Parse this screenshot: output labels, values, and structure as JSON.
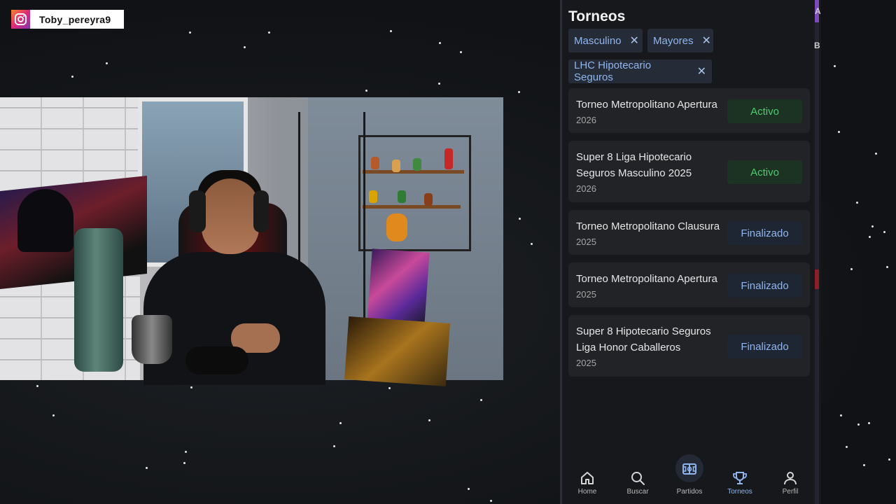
{
  "overlay": {
    "instagram_handle": "Toby_pereyra9"
  },
  "app": {
    "title": "Torneos",
    "filters": [
      {
        "label": "Masculino"
      },
      {
        "label": "Mayores"
      },
      {
        "label": "LHC Hipotecario Seguros"
      }
    ],
    "filter_remove_glyph": "✕",
    "tournaments": [
      {
        "name": "Torneo Metropolitano Apertura",
        "year": "2026",
        "status": "Activo"
      },
      {
        "name": "Super 8 Liga Hipotecario Seguros Masculino 2025",
        "year": "2026",
        "status": "Activo"
      },
      {
        "name": "Torneo Metropolitano Clausura",
        "year": "2025",
        "status": "Finalizado"
      },
      {
        "name": "Torneo Metropolitano Apertura",
        "year": "2025",
        "status": "Finalizado"
      },
      {
        "name": "Super 8 Hipotecario Seguros Liga Honor Caballeros",
        "year": "2025",
        "status": "Finalizado"
      }
    ],
    "nav": [
      {
        "label": "Home",
        "icon": "home-icon"
      },
      {
        "label": "Buscar",
        "icon": "search-icon"
      },
      {
        "label": "Partidos",
        "icon": "field-icon"
      },
      {
        "label": "Torneos",
        "icon": "trophy-icon",
        "selected": true
      },
      {
        "label": "Perfil",
        "icon": "person-icon"
      }
    ],
    "edge_text": [
      "A",
      "B"
    ]
  },
  "colors": {
    "accent": "#8fb6ee",
    "active_green": "#4ccd6a",
    "background": "#17181c"
  }
}
